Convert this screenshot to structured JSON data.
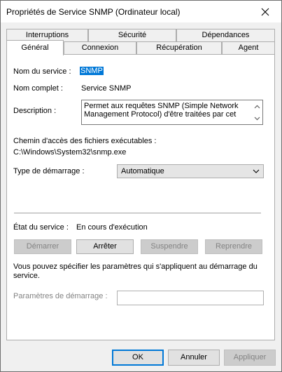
{
  "window": {
    "title": "Propriétés de Service SNMP (Ordinateur local)"
  },
  "tabs": {
    "row1": [
      "Interruptions",
      "Sécurité",
      "Dépendances"
    ],
    "row2": [
      "Général",
      "Connexion",
      "Récupération",
      "Agent"
    ],
    "active": "Général"
  },
  "general": {
    "service_name_label": "Nom du service :",
    "service_name_value": "SNMP",
    "full_name_label": "Nom complet :",
    "full_name_value": "Service SNMP",
    "description_label": "Description :",
    "description_value": "Permet aux requêtes SNMP (Simple Network Management Protocol) d'être traitées par cet",
    "exe_path_label": "Chemin d'accès des fichiers exécutables :",
    "exe_path_value": "C:\\Windows\\System32\\snmp.exe",
    "startup_type_label": "Type de démarrage :",
    "startup_type_value": "Automatique",
    "status_label": "État du service :",
    "status_value": "En cours d'exécution",
    "buttons": {
      "start": "Démarrer",
      "stop": "Arrêter",
      "pause": "Suspendre",
      "resume": "Reprendre"
    },
    "hint_text": "Vous pouvez spécifier les paramètres qui s'appliquent au démarrage du service.",
    "params_label": "Paramètres de démarrage :",
    "params_value": ""
  },
  "dialog_buttons": {
    "ok": "OK",
    "cancel": "Annuler",
    "apply": "Appliquer"
  },
  "colors": {
    "selection": "#0078d7",
    "panel": "#ffffff",
    "window": "#f0f0f0"
  }
}
